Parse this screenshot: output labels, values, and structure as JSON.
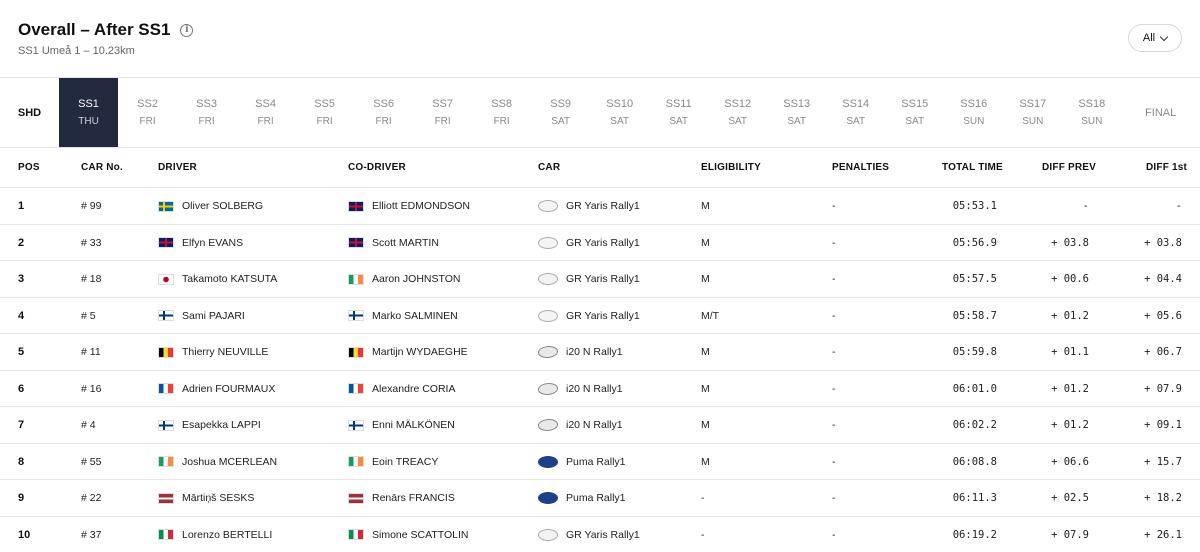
{
  "header": {
    "title": "Overall – After SS1",
    "subtitle": "SS1 Umeå 1 – 10.23km",
    "filter_label": "All"
  },
  "tabs": [
    {
      "label": "SHD",
      "day": ""
    },
    {
      "label": "SS1",
      "day": "THU"
    },
    {
      "label": "SS2",
      "day": "FRI"
    },
    {
      "label": "SS3",
      "day": "FRI"
    },
    {
      "label": "SS4",
      "day": "FRI"
    },
    {
      "label": "SS5",
      "day": "FRI"
    },
    {
      "label": "SS6",
      "day": "FRI"
    },
    {
      "label": "SS7",
      "day": "FRI"
    },
    {
      "label": "SS8",
      "day": "FRI"
    },
    {
      "label": "SS9",
      "day": "SAT"
    },
    {
      "label": "SS10",
      "day": "SAT"
    },
    {
      "label": "SS11",
      "day": "SAT"
    },
    {
      "label": "SS12",
      "day": "SAT"
    },
    {
      "label": "SS13",
      "day": "SAT"
    },
    {
      "label": "SS14",
      "day": "SAT"
    },
    {
      "label": "SS15",
      "day": "SAT"
    },
    {
      "label": "SS16",
      "day": "SUN"
    },
    {
      "label": "SS17",
      "day": "SUN"
    },
    {
      "label": "SS18",
      "day": "SUN"
    },
    {
      "label": "FINAL",
      "day": ""
    }
  ],
  "active_tab": "SS1",
  "table": {
    "headers": {
      "pos": "POS",
      "car_no": "CAR No.",
      "driver": "DRIVER",
      "co_driver": "CO-DRIVER",
      "car": "CAR",
      "eligibility": "ELIGIBILITY",
      "penalties": "PENALTIES",
      "total_time": "TOTAL TIME",
      "diff_prev": "DIFF PREV",
      "diff_first": "DIFF 1st"
    },
    "rows": [
      {
        "pos": "1",
        "car_no": "# 99",
        "driver": "Oliver SOLBERG",
        "driver_flag": "se",
        "co_driver": "Elliott EDMONDSON",
        "co_flag": "gb",
        "car": "GR Yaris Rally1",
        "make": "toyota",
        "eligibility": "M",
        "penalties": "-",
        "total_time": "05:53.1",
        "diff_prev": "-",
        "diff_first": "-"
      },
      {
        "pos": "2",
        "car_no": "# 33",
        "driver": "Elfyn EVANS",
        "driver_flag": "gb",
        "co_driver": "Scott MARTIN",
        "co_flag": "gb",
        "car": "GR Yaris Rally1",
        "make": "toyota",
        "eligibility": "M",
        "penalties": "-",
        "total_time": "05:56.9",
        "diff_prev": "+ 03.8",
        "diff_first": "+ 03.8"
      },
      {
        "pos": "3",
        "car_no": "# 18",
        "driver": "Takamoto KATSUTA",
        "driver_flag": "jp",
        "co_driver": "Aaron JOHNSTON",
        "co_flag": "ie",
        "car": "GR Yaris Rally1",
        "make": "toyota",
        "eligibility": "M",
        "penalties": "-",
        "total_time": "05:57.5",
        "diff_prev": "+ 00.6",
        "diff_first": "+ 04.4"
      },
      {
        "pos": "4",
        "car_no": "# 5",
        "driver": "Sami PAJARI",
        "driver_flag": "fi",
        "co_driver": "Marko SALMINEN",
        "co_flag": "fi",
        "car": "GR Yaris Rally1",
        "make": "toyota",
        "eligibility": "M/T",
        "penalties": "-",
        "total_time": "05:58.7",
        "diff_prev": "+ 01.2",
        "diff_first": "+ 05.6"
      },
      {
        "pos": "5",
        "car_no": "# 11",
        "driver": "Thierry NEUVILLE",
        "driver_flag": "be",
        "co_driver": "Martijn WYDAEGHE",
        "co_flag": "be",
        "car": "i20 N Rally1",
        "make": "hyundai",
        "eligibility": "M",
        "penalties": "-",
        "total_time": "05:59.8",
        "diff_prev": "+ 01.1",
        "diff_first": "+ 06.7"
      },
      {
        "pos": "6",
        "car_no": "# 16",
        "driver": "Adrien FOURMAUX",
        "driver_flag": "fr",
        "co_driver": "Alexandre CORIA",
        "co_flag": "fr",
        "car": "i20 N Rally1",
        "make": "hyundai",
        "eligibility": "M",
        "penalties": "-",
        "total_time": "06:01.0",
        "diff_prev": "+ 01.2",
        "diff_first": "+ 07.9"
      },
      {
        "pos": "7",
        "car_no": "# 4",
        "driver": "Esapekka LAPPI",
        "driver_flag": "fi",
        "co_driver": "Enni MÄLKÖNEN",
        "co_flag": "fi",
        "car": "i20 N Rally1",
        "make": "hyundai",
        "eligibility": "M",
        "penalties": "-",
        "total_time": "06:02.2",
        "diff_prev": "+ 01.2",
        "diff_first": "+ 09.1"
      },
      {
        "pos": "8",
        "car_no": "# 55",
        "driver": "Joshua MCERLEAN",
        "driver_flag": "ie",
        "co_driver": "Eoin TREACY",
        "co_flag": "ie",
        "car": "Puma Rally1",
        "make": "ford",
        "eligibility": "M",
        "penalties": "-",
        "total_time": "06:08.8",
        "diff_prev": "+ 06.6",
        "diff_first": "+ 15.7"
      },
      {
        "pos": "9",
        "car_no": "# 22",
        "driver": "Mārtiņš SESKS",
        "driver_flag": "lv",
        "co_driver": "Renārs FRANCIS",
        "co_flag": "lv",
        "car": "Puma Rally1",
        "make": "ford",
        "eligibility": "-",
        "penalties": "-",
        "total_time": "06:11.3",
        "diff_prev": "+ 02.5",
        "diff_first": "+ 18.2"
      },
      {
        "pos": "10",
        "car_no": "# 37",
        "driver": "Lorenzo BERTELLI",
        "driver_flag": "it",
        "co_driver": "Simone SCATTOLIN",
        "co_flag": "it",
        "car": "GR Yaris Rally1",
        "make": "toyota",
        "eligibility": "-",
        "penalties": "-",
        "total_time": "06:19.2",
        "diff_prev": "+ 07.9",
        "diff_first": "+ 26.1"
      }
    ]
  },
  "colors": {
    "active_tab_bg": "#222a3f",
    "border": "#e3e3e3"
  }
}
